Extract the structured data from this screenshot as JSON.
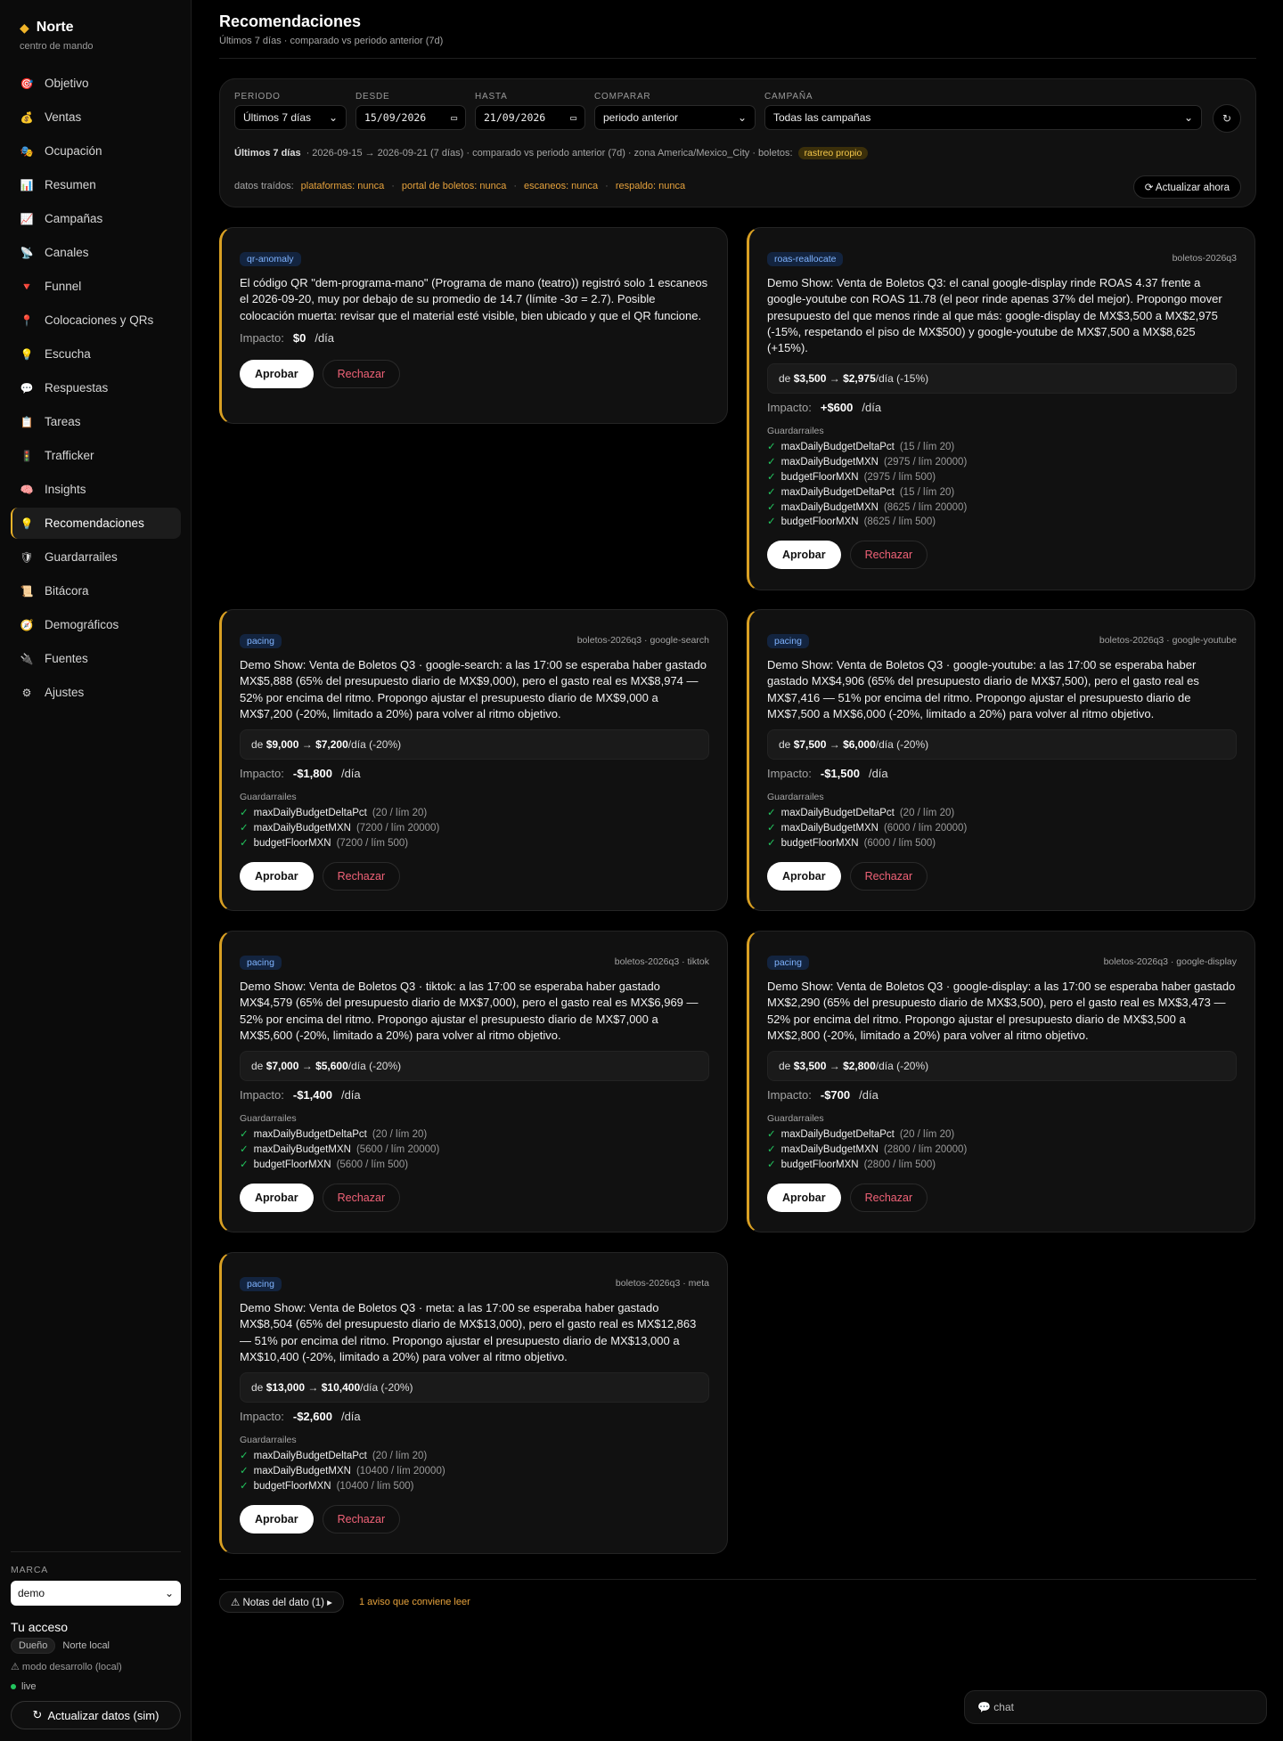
{
  "brand": {
    "name": "Norte",
    "subtitle": "centro de mando"
  },
  "nav": [
    {
      "icon": "🎯",
      "label": "Objetivo"
    },
    {
      "icon": "💰",
      "label": "Ventas"
    },
    {
      "icon": "🎭",
      "label": "Ocupación"
    },
    {
      "icon": "📊",
      "label": "Resumen"
    },
    {
      "icon": "📈",
      "label": "Campañas"
    },
    {
      "icon": "📡",
      "label": "Canales"
    },
    {
      "icon": "🔻",
      "label": "Funnel"
    },
    {
      "icon": "📍",
      "label": "Colocaciones y QRs"
    },
    {
      "icon": "💡",
      "label": "Escucha"
    },
    {
      "icon": "💬",
      "label": "Respuestas"
    },
    {
      "icon": "📋",
      "label": "Tareas"
    },
    {
      "icon": "🚦",
      "label": "Trafficker"
    },
    {
      "icon": "🧠",
      "label": "Insights"
    },
    {
      "icon": "💡",
      "label": "Recomendaciones"
    },
    {
      "icon": "🛡",
      "label": "Guardarrailes"
    },
    {
      "icon": "📜",
      "label": "Bitácora"
    },
    {
      "icon": "🧭",
      "label": "Demográficos"
    },
    {
      "icon": "🔌",
      "label": "Fuentes"
    },
    {
      "icon": "⚙",
      "label": "Ajustes"
    }
  ],
  "sidebar_bottom": {
    "marca_label": "MARCA",
    "marca_value": "demo",
    "access_title": "Tu acceso",
    "role": "Dueño",
    "org": "Norte local",
    "dev_note": "⚠ modo desarrollo (local)",
    "live": "live",
    "sim_button": "Actualizar datos (sim)"
  },
  "header": {
    "title": "Recomendaciones",
    "subtitle": "Últimos 7 días · comparado vs periodo anterior (7d)"
  },
  "filters": {
    "periodo_label": "PERIODO",
    "periodo_value": "Últimos 7 días",
    "desde_label": "DESDE",
    "desde_value": "15/09/2026",
    "hasta_label": "HASTA",
    "hasta_value": "21/09/2026",
    "comparar_label": "COMPARAR",
    "comparar_value": "periodo anterior",
    "campana_label": "CAMPAÑA",
    "campana_value": "Todas las campañas",
    "summary_bold": "Últimos 7 días",
    "summary_text": "· 2026-09-15 → 2026-09-21 (7 días) · comparado vs periodo anterior (7d) · zona America/Mexico_City · boletos:",
    "boletos_tag": "rastreo propio",
    "sources_label": "datos traídos:",
    "sources": [
      "plataformas: nunca",
      "portal de boletos: nunca",
      "escaneos: nunca",
      "respaldo: nunca"
    ],
    "update_button": "⟳ Actualizar ahora"
  },
  "labels": {
    "impact": "Impacto:",
    "per_day": "/día",
    "guardrails": "Guardarrailes",
    "approve": "Aprobar",
    "reject": "Rechazar"
  },
  "cards": [
    {
      "type": "qr-anomaly",
      "ref": "",
      "text": "El código QR \"dem-programa-mano\" (Programa de mano (teatro)) registró solo 1 escaneos el 2026-09-20, muy por debajo de su promedio de 14.7 (límite -3σ = 2.7). Posible colocación muerta: revisar que el material esté visible, bien ubicado y que el QR funcione.",
      "change": null,
      "impact": "$0",
      "guardrails": []
    },
    {
      "type": "roas-reallocate",
      "ref": "boletos-2026q3",
      "text": "Demo Show: Venta de Boletos Q3: el canal google-display rinde ROAS 4.37 frente a google-youtube con ROAS 11.78 (el peor rinde apenas 37% del mejor). Propongo mover presupuesto del que menos rinde al que más: google-display de MX$3,500 a MX$2,975 (-15%, respetando el piso de MX$500) y google-youtube de MX$7,500 a MX$8,625 (+15%).",
      "change": {
        "from": "$3,500",
        "to": "$2,975",
        "suffix": "/día (-15%)"
      },
      "impact": "+$600",
      "guardrails": [
        {
          "name": "maxDailyBudgetDeltaPct",
          "meta": "(15 / lím 20)"
        },
        {
          "name": "maxDailyBudgetMXN",
          "meta": "(2975 / lím 20000)"
        },
        {
          "name": "budgetFloorMXN",
          "meta": "(2975 / lím 500)"
        },
        {
          "name": "maxDailyBudgetDeltaPct",
          "meta": "(15 / lím 20)"
        },
        {
          "name": "maxDailyBudgetMXN",
          "meta": "(8625 / lím 20000)"
        },
        {
          "name": "budgetFloorMXN",
          "meta": "(8625 / lím 500)"
        }
      ]
    },
    {
      "type": "pacing",
      "ref": "boletos-2026q3 · google-search",
      "text": "Demo Show: Venta de Boletos Q3 · google-search: a las 17:00 se esperaba haber gastado MX$5,888 (65% del presupuesto diario de MX$9,000), pero el gasto real es MX$8,974 — 52% por encima del ritmo. Propongo ajustar el presupuesto diario de MX$9,000 a MX$7,200 (-20%, limitado a 20%) para volver al ritmo objetivo.",
      "change": {
        "from": "$9,000",
        "to": "$7,200",
        "suffix": "/día (-20%)"
      },
      "impact": "-$1,800",
      "guardrails": [
        {
          "name": "maxDailyBudgetDeltaPct",
          "meta": "(20 / lím 20)"
        },
        {
          "name": "maxDailyBudgetMXN",
          "meta": "(7200 / lím 20000)"
        },
        {
          "name": "budgetFloorMXN",
          "meta": "(7200 / lím 500)"
        }
      ]
    },
    {
      "type": "pacing",
      "ref": "boletos-2026q3 · google-youtube",
      "text": "Demo Show: Venta de Boletos Q3 · google-youtube: a las 17:00 se esperaba haber gastado MX$4,906 (65% del presupuesto diario de MX$7,500), pero el gasto real es MX$7,416 — 51% por encima del ritmo. Propongo ajustar el presupuesto diario de MX$7,500 a MX$6,000 (-20%, limitado a 20%) para volver al ritmo objetivo.",
      "change": {
        "from": "$7,500",
        "to": "$6,000",
        "suffix": "/día (-20%)"
      },
      "impact": "-$1,500",
      "guardrails": [
        {
          "name": "maxDailyBudgetDeltaPct",
          "meta": "(20 / lím 20)"
        },
        {
          "name": "maxDailyBudgetMXN",
          "meta": "(6000 / lím 20000)"
        },
        {
          "name": "budgetFloorMXN",
          "meta": "(6000 / lím 500)"
        }
      ]
    },
    {
      "type": "pacing",
      "ref": "boletos-2026q3 · tiktok",
      "text": "Demo Show: Venta de Boletos Q3 · tiktok: a las 17:00 se esperaba haber gastado MX$4,579 (65% del presupuesto diario de MX$7,000), pero el gasto real es MX$6,969 — 52% por encima del ritmo. Propongo ajustar el presupuesto diario de MX$7,000 a MX$5,600 (-20%, limitado a 20%) para volver al ritmo objetivo.",
      "change": {
        "from": "$7,000",
        "to": "$5,600",
        "suffix": "/día (-20%)"
      },
      "impact": "-$1,400",
      "guardrails": [
        {
          "name": "maxDailyBudgetDeltaPct",
          "meta": "(20 / lím 20)"
        },
        {
          "name": "maxDailyBudgetMXN",
          "meta": "(5600 / lím 20000)"
        },
        {
          "name": "budgetFloorMXN",
          "meta": "(5600 / lím 500)"
        }
      ]
    },
    {
      "type": "pacing",
      "ref": "boletos-2026q3 · google-display",
      "text": "Demo Show: Venta de Boletos Q3 · google-display: a las 17:00 se esperaba haber gastado MX$2,290 (65% del presupuesto diario de MX$3,500), pero el gasto real es MX$3,473 — 52% por encima del ritmo. Propongo ajustar el presupuesto diario de MX$3,500 a MX$2,800 (-20%, limitado a 20%) para volver al ritmo objetivo.",
      "change": {
        "from": "$3,500",
        "to": "$2,800",
        "suffix": "/día (-20%)"
      },
      "impact": "-$700",
      "guardrails": [
        {
          "name": "maxDailyBudgetDeltaPct",
          "meta": "(20 / lím 20)"
        },
        {
          "name": "maxDailyBudgetMXN",
          "meta": "(2800 / lím 20000)"
        },
        {
          "name": "budgetFloorMXN",
          "meta": "(2800 / lím 500)"
        }
      ]
    },
    {
      "type": "pacing",
      "ref": "boletos-2026q3 · meta",
      "text": "Demo Show: Venta de Boletos Q3 · meta: a las 17:00 se esperaba haber gastado MX$8,504 (65% del presupuesto diario de MX$13,000), pero el gasto real es MX$12,863 — 51% por encima del ritmo. Propongo ajustar el presupuesto diario de MX$13,000 a MX$10,400 (-20%, limitado a 20%) para volver al ritmo objetivo.",
      "change": {
        "from": "$13,000",
        "to": "$10,400",
        "suffix": "/día (-20%)"
      },
      "impact": "-$2,600",
      "guardrails": [
        {
          "name": "maxDailyBudgetDeltaPct",
          "meta": "(20 / lím 20)"
        },
        {
          "name": "maxDailyBudgetMXN",
          "meta": "(10400 / lím 20000)"
        },
        {
          "name": "budgetFloorMXN",
          "meta": "(10400 / lím 500)"
        }
      ]
    }
  ],
  "footer": {
    "notes_button": "⚠ Notas del dato (1) ▸",
    "notes_warning": "1 aviso que conviene leer",
    "chat": "💬 chat"
  }
}
